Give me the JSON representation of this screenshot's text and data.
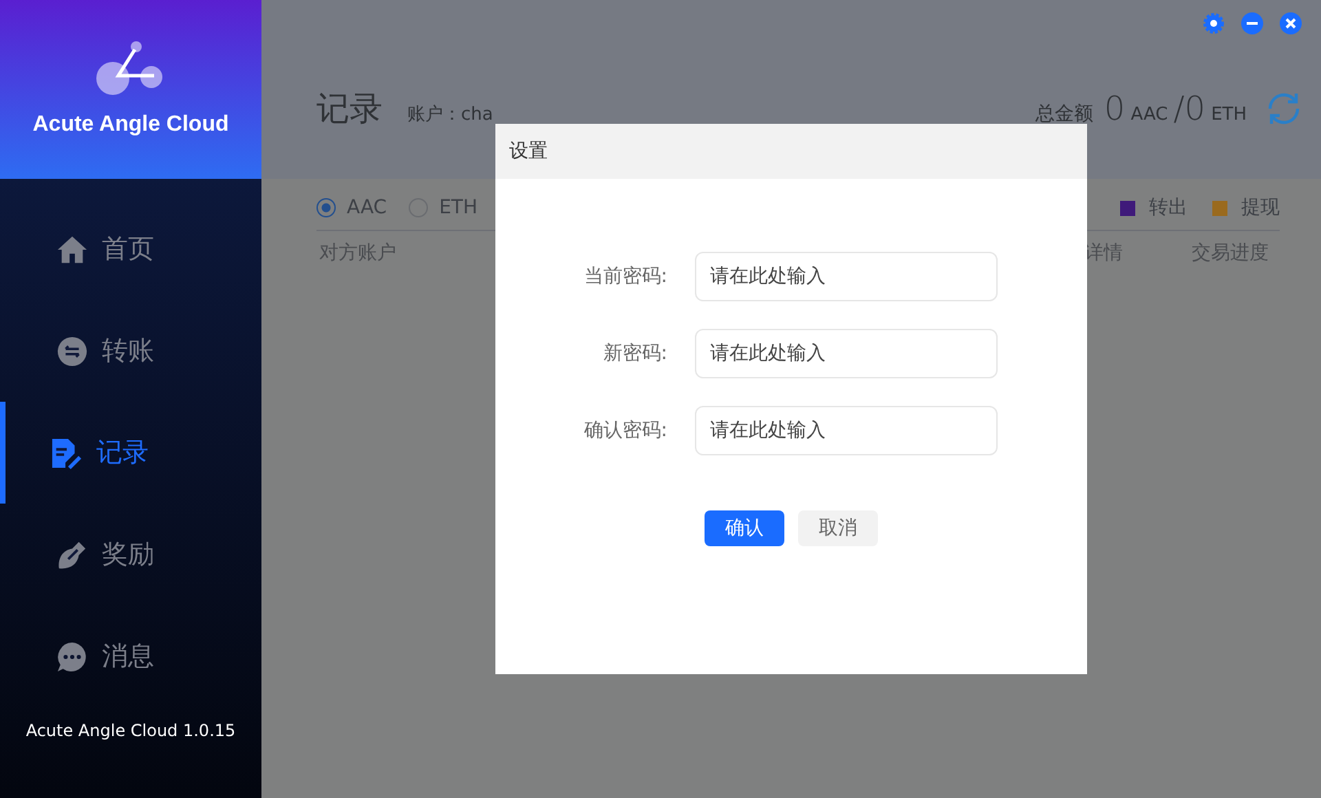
{
  "app": {
    "name": "Acute Angle Cloud",
    "version": "Acute Angle Cloud 1.0.15"
  },
  "sidebar": {
    "items": [
      {
        "label": "首页",
        "kind": "home",
        "selected": false
      },
      {
        "label": "转账",
        "kind": "transfer",
        "selected": false
      },
      {
        "label": "记录",
        "kind": "records",
        "selected": true
      },
      {
        "label": "奖励",
        "kind": "rewards",
        "selected": false
      },
      {
        "label": "消息",
        "kind": "messages",
        "selected": false
      }
    ]
  },
  "page": {
    "title": "记录",
    "account": "账户：cha",
    "total_label": "总金额",
    "aac_amount": "0",
    "aac_unit": "AAC",
    "separator": "/",
    "eth_amount": "0",
    "eth_unit": "ETH"
  },
  "currency_options": [
    {
      "label": "AAC",
      "selected": true
    },
    {
      "label": "ETH",
      "selected": false
    }
  ],
  "legend": [
    {
      "label": "转出",
      "color": "#3f1a7a"
    },
    {
      "label": "提现",
      "color": "#9a6a1e"
    }
  ],
  "table": {
    "columns": [
      "对方账户",
      "详情",
      "交易进度"
    ]
  },
  "dialog": {
    "title": "设置",
    "fields": [
      {
        "label": "当前密码:",
        "placeholder": "请在此处输入"
      },
      {
        "label": "新密码:",
        "placeholder": "请在此处输入"
      },
      {
        "label": "确认密码:",
        "placeholder": "请在此处输入"
      }
    ],
    "buttons": [
      {
        "label": "确认",
        "kind": "primary"
      },
      {
        "label": "取消",
        "kind": "secondary"
      }
    ]
  }
}
